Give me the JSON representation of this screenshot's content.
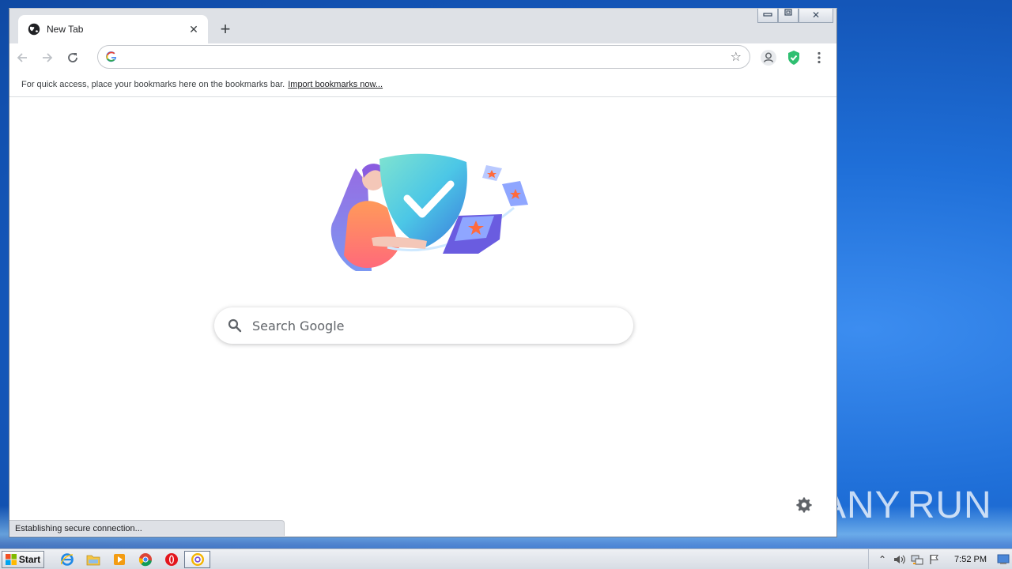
{
  "browser": {
    "tab": {
      "title": "New Tab",
      "close_label": "✕"
    },
    "new_tab_label": "+",
    "window_controls": {
      "minimize": "▭",
      "restore": "⧉",
      "close": "✕"
    },
    "omnibox": {
      "value": "",
      "placeholder": ""
    },
    "bookmarks_bar": {
      "message": "For quick access, place your bookmarks here on the bookmarks bar.",
      "link": "Import bookmarks now..."
    },
    "search": {
      "placeholder": "Search Google"
    },
    "status": "Establishing secure connection..."
  },
  "watermark": {
    "left": "ANY",
    "right": "RUN"
  },
  "taskbar": {
    "start_label": "Start",
    "apps": [
      "internet-explorer-icon",
      "file-explorer-icon",
      "media-player-icon",
      "chrome-icon",
      "opera-icon",
      "browser-active-icon"
    ],
    "clock": "7:52 PM"
  },
  "colors": {
    "accent_shield": "#2fbf71",
    "desktop": "#1f63c9",
    "tab_strip": "#dee1e6"
  }
}
